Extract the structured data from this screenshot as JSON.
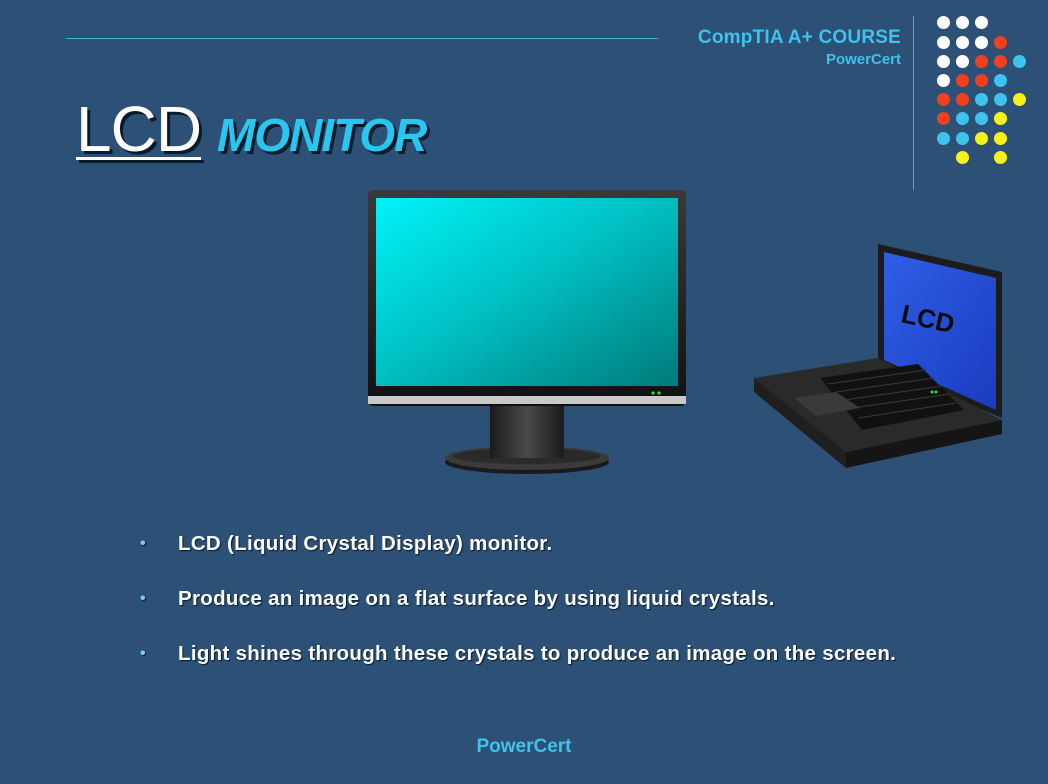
{
  "header": {
    "course_title": "CompTIA A+ COURSE",
    "brand": "PowerCert"
  },
  "slide": {
    "title_main": "LCD",
    "title_sub": "MONITOR"
  },
  "images": {
    "laptop_screen_text": "LCD"
  },
  "bullets": [
    "LCD (Liquid Crystal Display) monitor.",
    "Produce an image on a flat surface by using liquid crystals.",
    "Light shines through these crystals to produce an image on the screen."
  ],
  "footer": {
    "brand": "PowerCert"
  },
  "colors": {
    "background": "#2c5076",
    "accent": "#3ec3ec",
    "dot_white": "#ffffff",
    "dot_red": "#f0401e",
    "dot_cyan": "#3ec3ec",
    "dot_yellow": "#f7f11a"
  }
}
